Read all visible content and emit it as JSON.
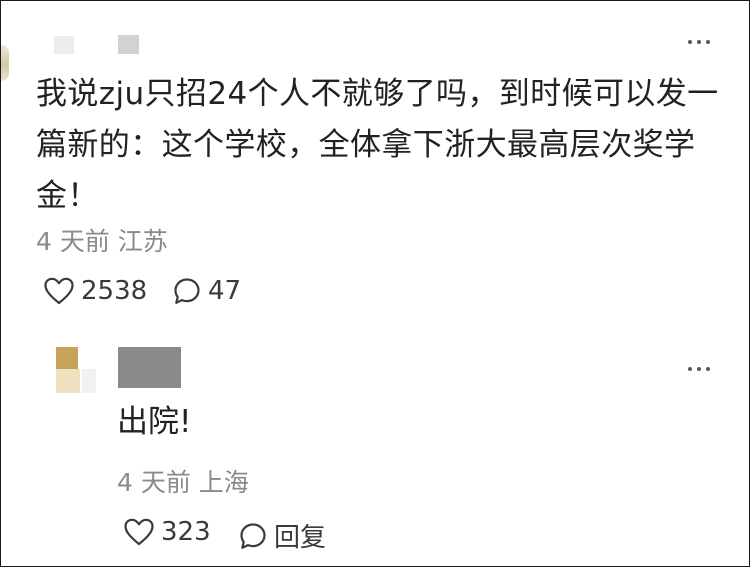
{
  "comment": {
    "text": "我说zju只招24个人不就够了吗，到时候可以发一篇新的：这个学校，全体拿下浙大最高层次奖学金！",
    "meta": "4 天前 江苏",
    "likes": "2538",
    "replies": "47"
  },
  "reply": {
    "text": "出院!",
    "meta": "4 天前 上海",
    "likes": "323",
    "reply_label": "回复"
  },
  "icons": {
    "like": "heart-outline-icon",
    "comment": "speech-bubble-icon",
    "more": "more-dots-icon"
  },
  "colors": {
    "text": "#222222",
    "meta": "#8a8a8a",
    "action": "#3a3a3a"
  }
}
